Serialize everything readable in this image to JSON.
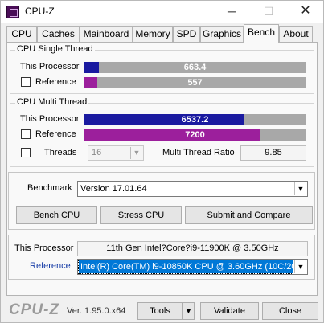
{
  "window": {
    "title": "CPU-Z"
  },
  "tabs": [
    {
      "label": "CPU"
    },
    {
      "label": "Caches"
    },
    {
      "label": "Mainboard"
    },
    {
      "label": "Memory"
    },
    {
      "label": "SPD"
    },
    {
      "label": "Graphics"
    },
    {
      "label": "Bench"
    },
    {
      "label": "About"
    }
  ],
  "active_tab": "Bench",
  "single_thread": {
    "title": "CPU Single Thread",
    "this_label": "This Processor",
    "this_value": "663.4",
    "ref_label": "Reference",
    "ref_value": "557",
    "this_fraction": 0.07,
    "ref_fraction": 0.06
  },
  "multi_thread": {
    "title": "CPU Multi Thread",
    "this_label": "This Processor",
    "this_value": "6537.2",
    "ref_label": "Reference",
    "ref_value": "7200",
    "this_fraction": 0.72,
    "ref_fraction": 0.79,
    "threads_label": "Threads",
    "threads_value": "16",
    "ratio_label": "Multi Thread Ratio",
    "ratio_value": "9.85"
  },
  "benchmark": {
    "label": "Benchmark",
    "version_value": "Version 17.01.64",
    "bench_cpu": "Bench CPU",
    "stress_cpu": "Stress CPU",
    "submit": "Submit and Compare"
  },
  "processor_info": {
    "this_label": "This Processor",
    "this_value": "11th Gen Intel?Core?i9-11900K @ 3.50GHz",
    "ref_label": "Reference",
    "ref_value": "Intel(R) Core(TM) i9-10850K CPU @ 3.60GHz (10C/20T)"
  },
  "footer": {
    "logo": "CPU-Z",
    "version": "Ver. 1.95.0.x64",
    "tools": "Tools",
    "validate": "Validate",
    "close": "Close"
  },
  "colors": {
    "this_processor_bar": "#1a1aa0",
    "reference_bar": "#9c1f9c",
    "bar_track": "#a8a8a8",
    "selection": "#0078d7"
  },
  "icons": {
    "minimize": "─",
    "maximize": "☐",
    "close": "✕",
    "dropdown": "▼"
  }
}
